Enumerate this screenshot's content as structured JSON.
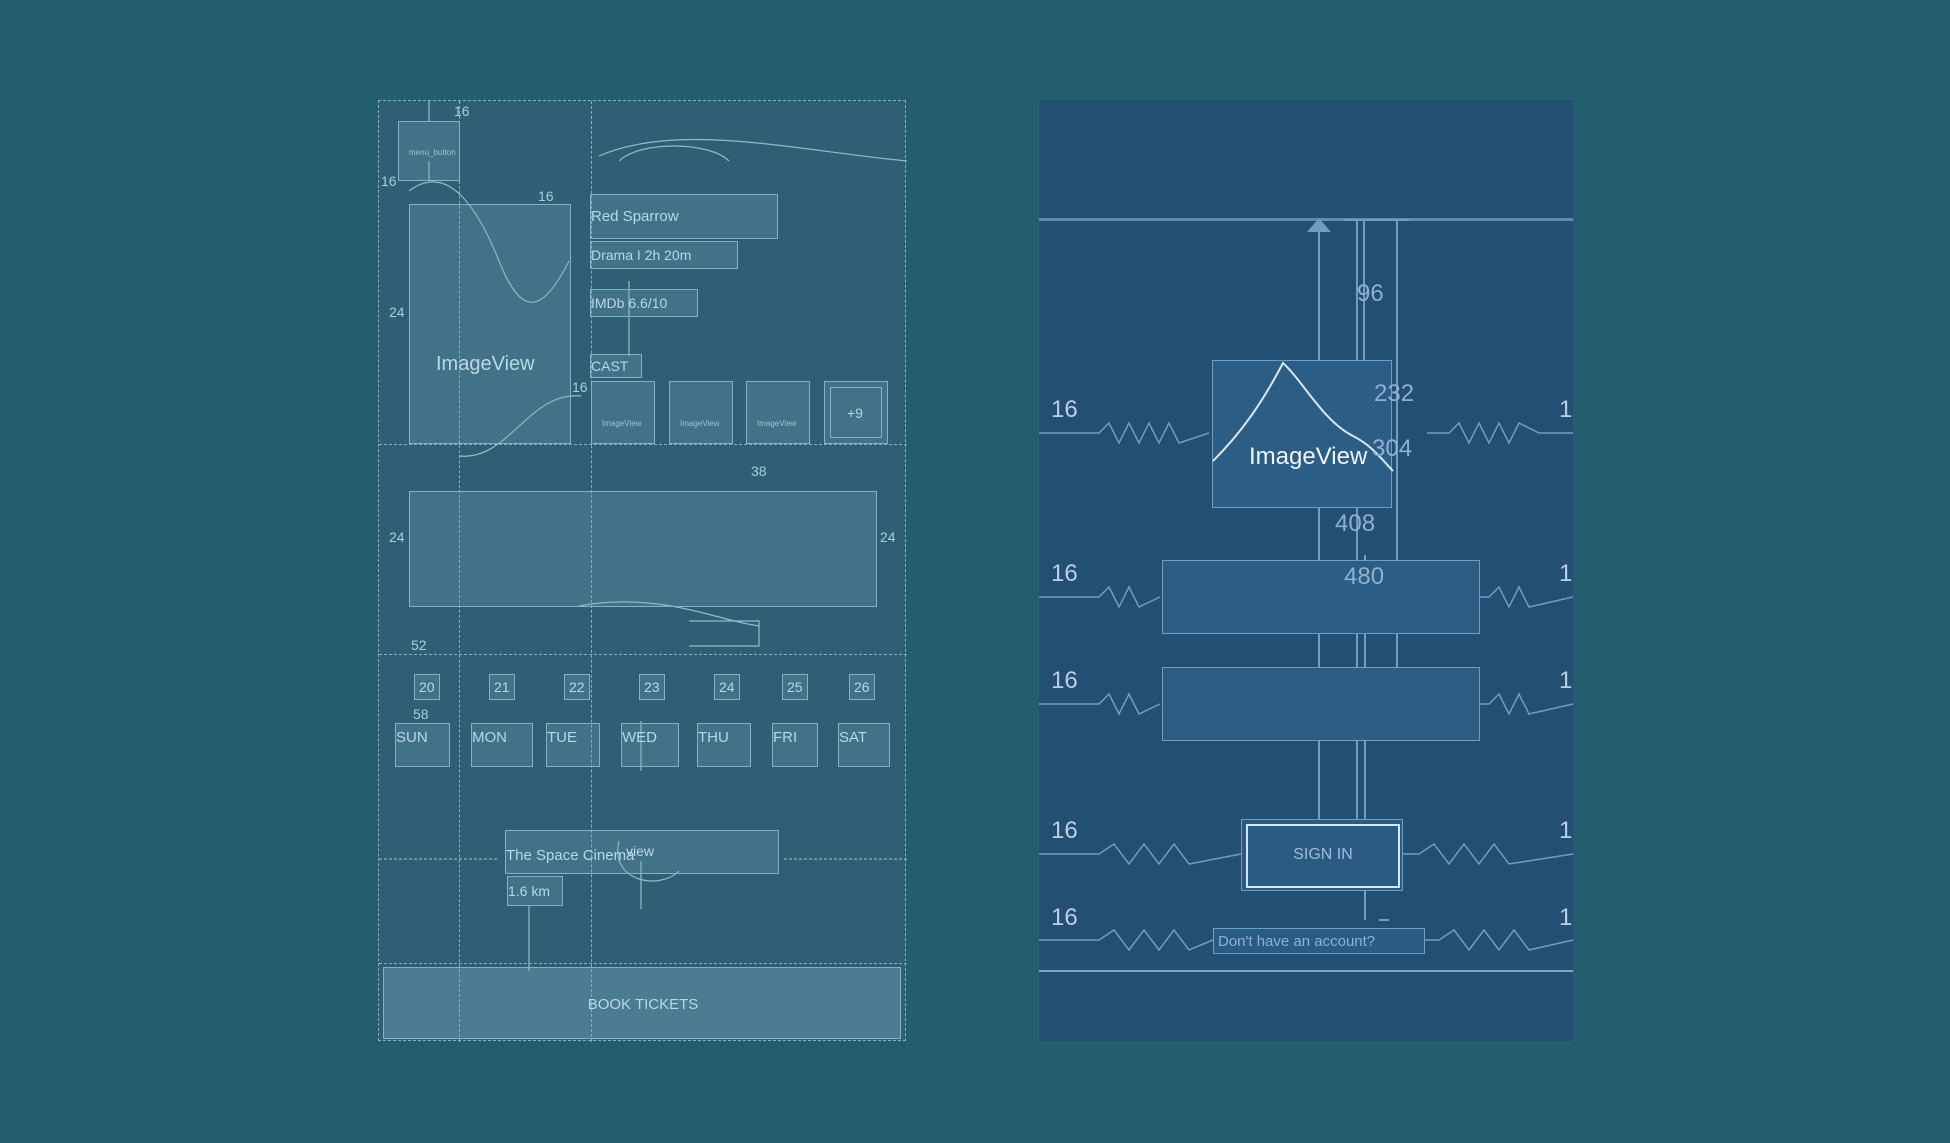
{
  "left_panel": {
    "menu_button_label": "menu_button",
    "imageview_label": "ImageView",
    "title": "Red Sparrow",
    "genre": "Drama I 2h 20m",
    "rating": "IMDb 6.6/10",
    "cast_label": "CAST",
    "cast_items": [
      "ImageView",
      "ImageView",
      "ImageView"
    ],
    "cast_more": "+9",
    "dates": [
      "20",
      "21",
      "22",
      "23",
      "24",
      "25",
      "26"
    ],
    "days": [
      "SUN",
      "MON",
      "TUE",
      "WED",
      "THU",
      "FRI",
      "SAT"
    ],
    "cinema_name": "The Space Cinema",
    "cinema_view_label": "view",
    "distance": "1.6 km",
    "book_button": "BOOK TICKETS",
    "dims": {
      "d16a": "16",
      "d16b": "16",
      "d16c": "16",
      "d16d": "16",
      "d16e": "16",
      "d24a": "24",
      "d24b": "24",
      "d24c": "24",
      "d38": "38",
      "d52": "52",
      "d58": "58"
    }
  },
  "right_panel": {
    "imageview_label": "ImageView",
    "signin_button": "SIGN IN",
    "no_account_link": "Don't have an account?",
    "dims": {
      "v96": "96",
      "v232": "232",
      "v304": "304",
      "v408": "408",
      "v480": "480",
      "m16": "16",
      "m1": "1"
    }
  },
  "colors": {
    "background": "#235e6e",
    "left_panel": "#2f5f75",
    "right_panel": "#234f72",
    "outline": "#80b3c7"
  }
}
